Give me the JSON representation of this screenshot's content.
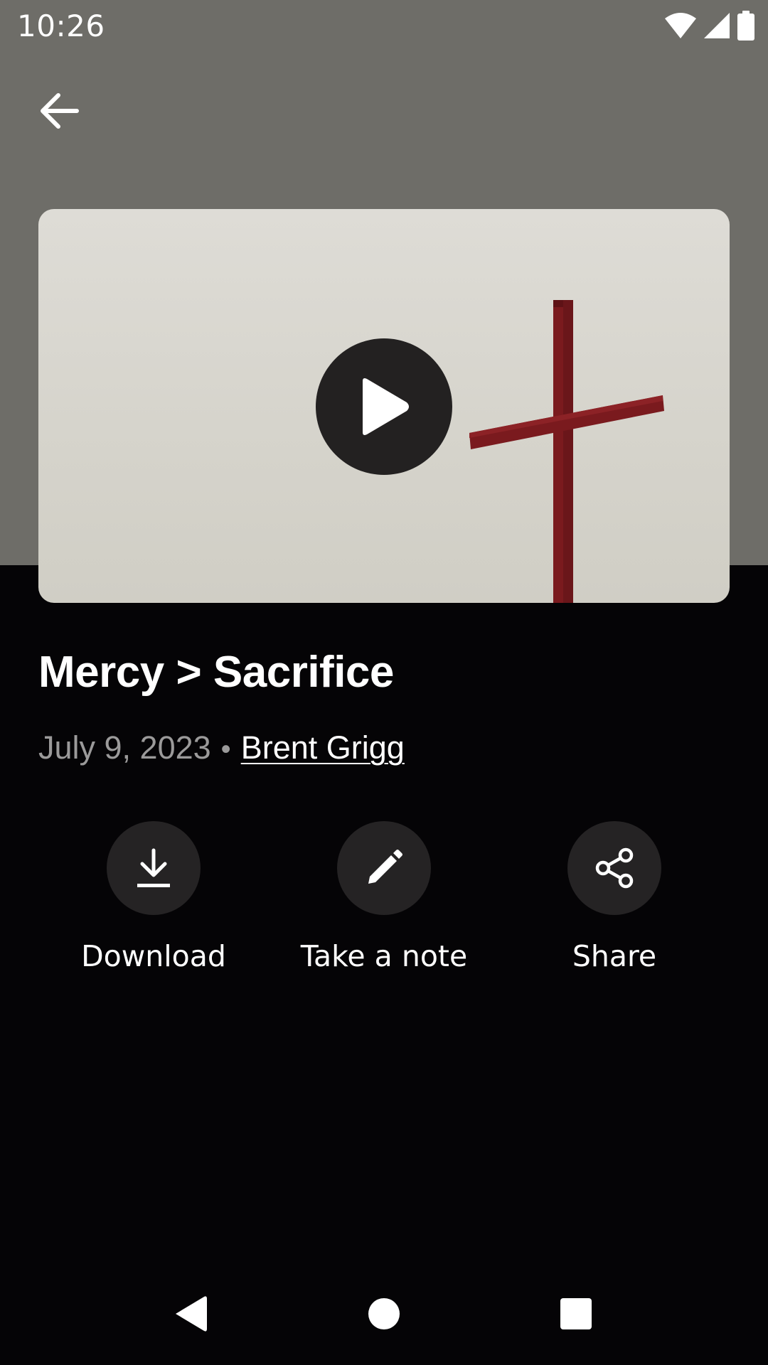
{
  "status_bar": {
    "time": "10:26",
    "icons": [
      "wifi-icon",
      "cellular-signal-icon",
      "battery-icon"
    ]
  },
  "header": {
    "back_icon": "arrow-back-icon"
  },
  "media": {
    "play_icon": "play-icon",
    "artwork": "red wooden cross against pale sky"
  },
  "sermon": {
    "title": "Mercy > Sacrifice",
    "date": "July 9, 2023",
    "separator": "•",
    "speaker": "Brent Grigg"
  },
  "actions": [
    {
      "label": "Download",
      "icon": "download-icon"
    },
    {
      "label": "Take a note",
      "icon": "pencil-icon"
    },
    {
      "label": "Share",
      "icon": "share-icon"
    }
  ],
  "navigation": {
    "buttons": [
      "back-triangle-icon",
      "home-circle-icon",
      "recents-square-icon"
    ]
  },
  "colors": {
    "top_background": "#6e6d68",
    "page_background": "#050406",
    "action_circle": "#252324",
    "play_circle": "#232121",
    "cross": "#7a1a1e",
    "meta_text": "#9b9a9a"
  }
}
